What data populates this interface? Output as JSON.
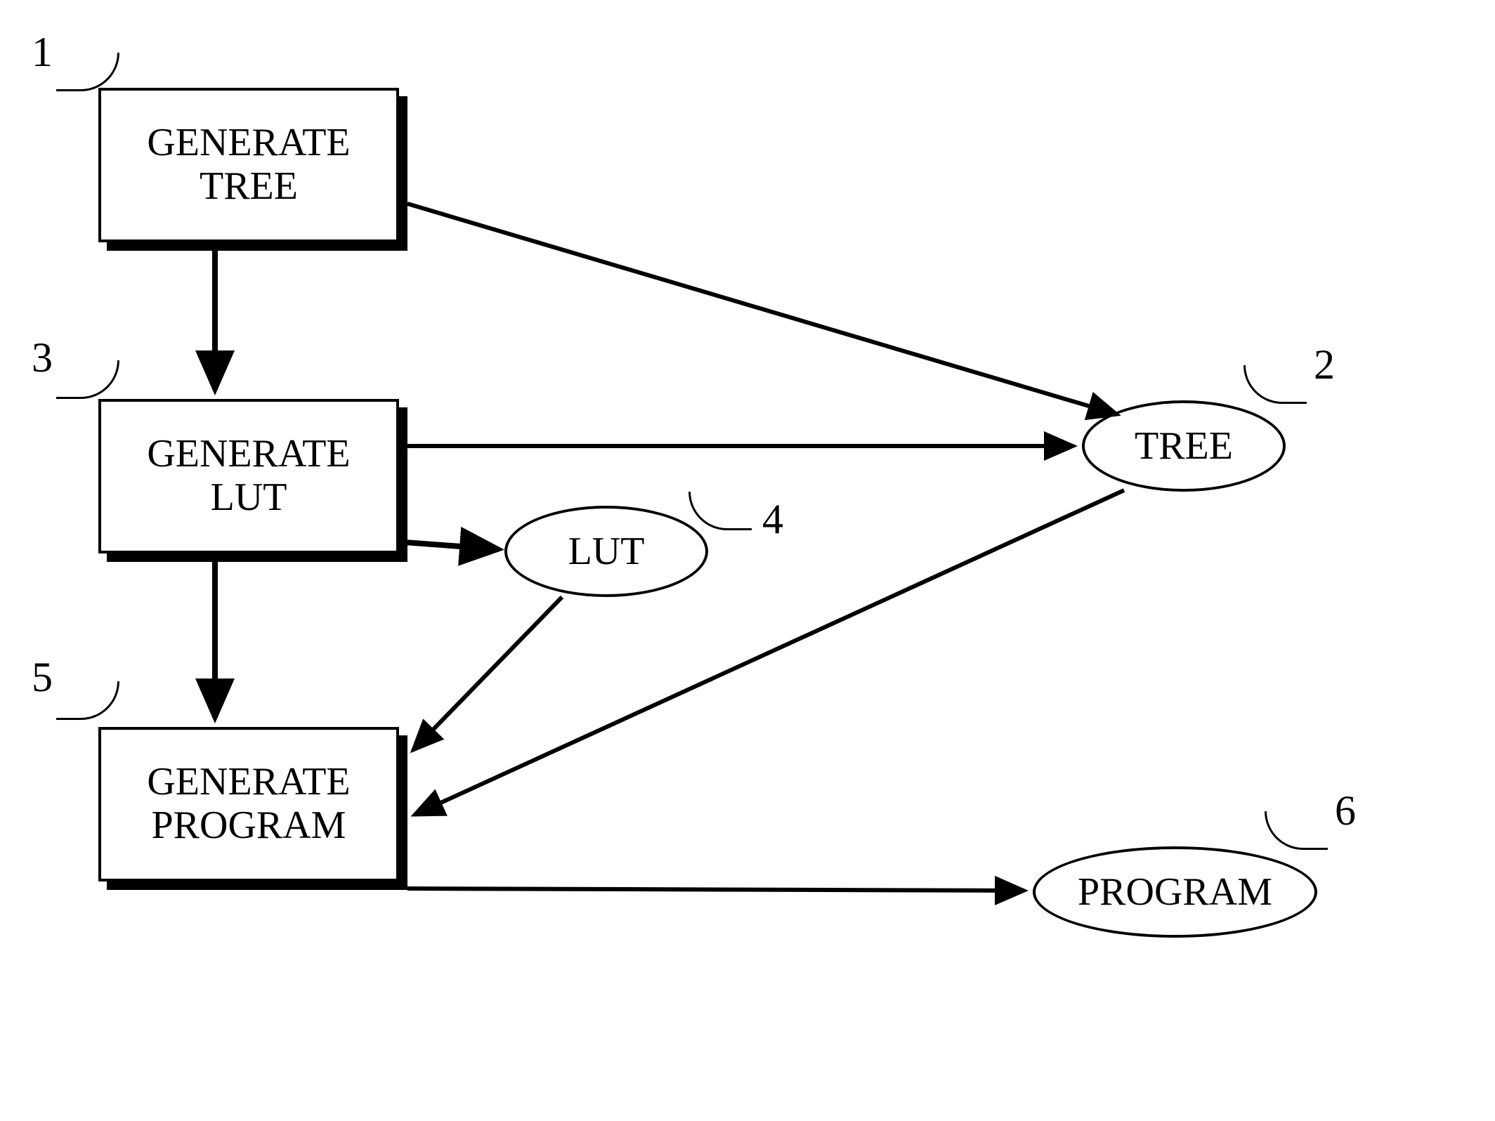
{
  "nodes": {
    "box1": {
      "label": "GENERATE\nTREE",
      "ref": "1"
    },
    "box3": {
      "label": "GENERATE\nLUT",
      "ref": "3"
    },
    "box5": {
      "label": "GENERATE\nPROGRAM",
      "ref": "5"
    },
    "ellipse2": {
      "label": "TREE",
      "ref": "2"
    },
    "ellipse4": {
      "label": "LUT",
      "ref": "4"
    },
    "ellipse6": {
      "label": "PROGRAM",
      "ref": "6"
    }
  },
  "edges": [
    {
      "from": "box1",
      "to": "box3"
    },
    {
      "from": "box1",
      "to": "ellipse2"
    },
    {
      "from": "box3",
      "to": "ellipse2"
    },
    {
      "from": "box3",
      "to": "ellipse4"
    },
    {
      "from": "box3",
      "to": "box5"
    },
    {
      "from": "ellipse4",
      "to": "box5"
    },
    {
      "from": "ellipse2",
      "to": "box5"
    },
    {
      "from": "box5",
      "to": "ellipse6"
    }
  ]
}
